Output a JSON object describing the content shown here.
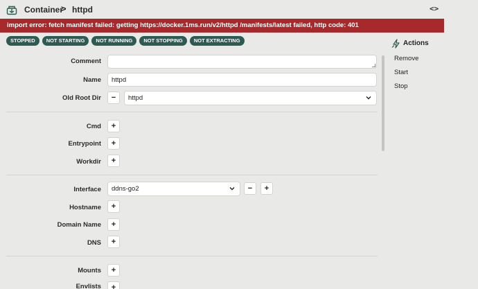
{
  "header": {
    "breadcrumb_root": "Container",
    "breadcrumb_separator": ">",
    "breadcrumb_current": "httpd",
    "code_toggle": "<>"
  },
  "error": {
    "message": "import error: fetch manifest failed: getting https://docker.1ms.run/v2/httpd /manifests/latest failed, http code: 401",
    "color": "#a7292b"
  },
  "badges": [
    "STOPPED",
    "NOT STARTING",
    "NOT RUNNING",
    "NOT STOPPING",
    "NOT EXTRACTING"
  ],
  "badge_color": "#2d5a52",
  "form": {
    "comment": {
      "label": "Comment",
      "value": ""
    },
    "name": {
      "label": "Name",
      "value": "httpd"
    },
    "old_root_dir": {
      "label": "Old Root Dir",
      "remove_label": "−",
      "value": "httpd"
    },
    "cmd": {
      "label": "Cmd",
      "add_label": "+"
    },
    "entrypoint": {
      "label": "Entrypoint",
      "add_label": "+"
    },
    "workdir": {
      "label": "Workdir",
      "add_label": "+"
    },
    "interface": {
      "label": "Interface",
      "value": "ddns-go2",
      "remove_label": "−",
      "add_label": "+"
    },
    "hostname": {
      "label": "Hostname",
      "add_label": "+"
    },
    "domain_name": {
      "label": "Domain Name",
      "add_label": "+"
    },
    "dns": {
      "label": "DNS",
      "add_label": "+"
    },
    "mounts": {
      "label": "Mounts",
      "add_label": "+"
    },
    "envlists": {
      "label": "Envlists",
      "add_label": "+"
    }
  },
  "sidebar": {
    "title": "Actions",
    "items": [
      "Remove",
      "Start",
      "Stop"
    ]
  }
}
